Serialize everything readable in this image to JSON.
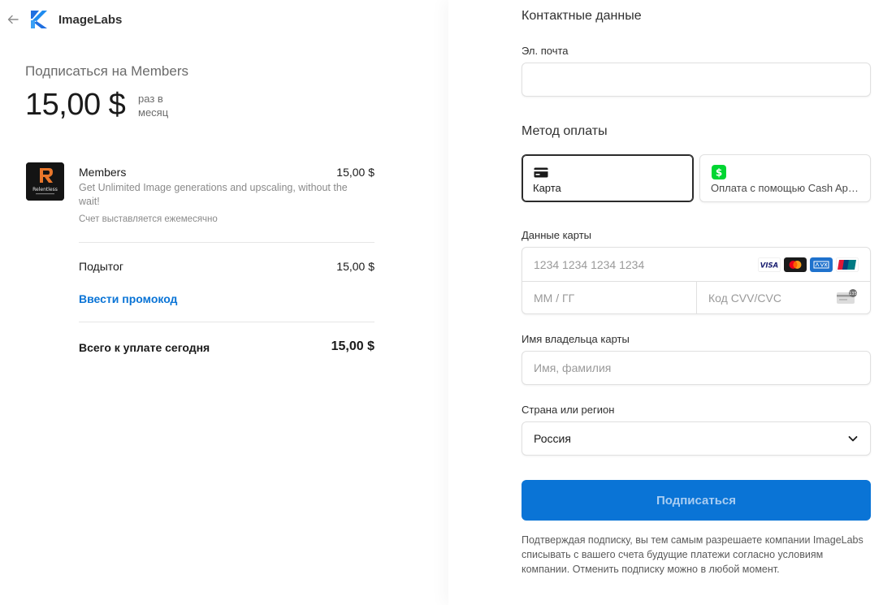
{
  "header": {
    "brand": "ImageLabs"
  },
  "summary": {
    "subscribe_title": "Подписаться на Members",
    "price": "15,00 $",
    "period": "раз в месяц",
    "product": {
      "name": "Members",
      "price": "15,00 $",
      "description": "Get Unlimited Image generations and upscaling, without the wait!",
      "billing_note": "Счет выставляется ежемесячно",
      "thumb_text": "Relentless"
    },
    "subtotal_label": "Подытог",
    "subtotal_value": "15,00 $",
    "promo_label": "Ввести промокод",
    "total_label": "Всего к уплате сегодня",
    "total_value": "15,00 $"
  },
  "form": {
    "contact_title": "Контактные данные",
    "email_label": "Эл. почта",
    "email_value": "",
    "payment_title": "Метод оплаты",
    "payment_options": [
      {
        "label": "Карта",
        "selected": true
      },
      {
        "label": "Оплата с помощью Cash App Pay",
        "selected": false
      }
    ],
    "card_label": "Данные карты",
    "card_number_placeholder": "1234 1234 1234 1234",
    "expiry_placeholder": "ММ / ГГ",
    "cvc_placeholder": "Код CVV/CVC",
    "card_brands": [
      "visa",
      "mastercard",
      "amex",
      "unionpay"
    ],
    "cardholder_label": "Имя владельца карты",
    "cardholder_placeholder": "Имя, фамилия",
    "country_label": "Страна или регион",
    "country_value": "Россия",
    "submit_label": "Подписаться",
    "terms": "Подтверждая подписку, вы тем самым разрешаете компании ImageLabs списывать с вашего счета будущие платежи согласно условиям компании. Отменить подписку можно в любой момент."
  },
  "colors": {
    "accent": "#0a74d6",
    "cash_app": "#00d632"
  }
}
